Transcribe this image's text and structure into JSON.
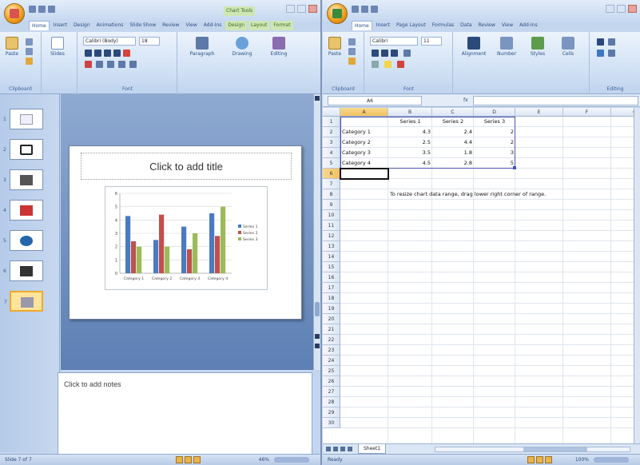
{
  "powerpoint": {
    "title_text": "",
    "tabs": [
      "Home",
      "Insert",
      "Design",
      "Animations",
      "Slide Show",
      "Review",
      "View",
      "Add-Ins",
      "Design",
      "Layout",
      "Format"
    ],
    "contextual_tab": "Chart Tools",
    "ribbon": {
      "paste_label": "Paste",
      "slides_label": "Slides",
      "font_name": "Calibri (Body)",
      "font_size": "18",
      "paragraph_label": "Paragraph",
      "drawing_label": "Drawing",
      "editing_label": "Editing",
      "clipboard_group": "Clipboard",
      "font_group": "Font"
    },
    "thumbnails": [
      {
        "num": "1",
        "icon": "title-slide"
      },
      {
        "num": "2",
        "icon": "shapes"
      },
      {
        "num": "3",
        "icon": "image"
      },
      {
        "num": "4",
        "icon": "diagram"
      },
      {
        "num": "5",
        "icon": "globe"
      },
      {
        "num": "6",
        "icon": "photo"
      },
      {
        "num": "7",
        "icon": "chart"
      }
    ],
    "slide": {
      "title_placeholder": "Click to add title"
    },
    "notes_placeholder": "Click to add notes",
    "status": {
      "slide_info": "Slide 7 of 7",
      "zoom": "46%"
    }
  },
  "excel": {
    "title_text": "",
    "tabs": [
      "Home",
      "Insert",
      "Page Layout",
      "Formulas",
      "Data",
      "Review",
      "View",
      "Add-Ins"
    ],
    "ribbon": {
      "paste_label": "Paste",
      "font_name": "Calibri",
      "font_size": "11",
      "alignment_label": "Alignment",
      "number_label": "Number",
      "styles_label": "Styles",
      "cells_label": "Cells",
      "clipboard_group": "Clipboard",
      "font_group": "Font",
      "editing_group": "Editing"
    },
    "name_box": "A6",
    "fx_label": "fx",
    "columns": [
      "A",
      "B",
      "C",
      "D",
      "E",
      "F",
      "G"
    ],
    "rows": [
      "1",
      "2",
      "3",
      "4",
      "5",
      "6",
      "7",
      "8",
      "9",
      "10",
      "11",
      "12",
      "13",
      "14",
      "15",
      "16",
      "17",
      "18",
      "19",
      "20",
      "21",
      "22",
      "23",
      "24",
      "25",
      "26",
      "27",
      "28",
      "29",
      "30"
    ],
    "cells": {
      "B1": "Series 1",
      "C1": "Series 2",
      "D1": "Series 3",
      "A2": "Category 1",
      "B2": "4.3",
      "C2": "2.4",
      "D2": "2",
      "A3": "Category 2",
      "B3": "2.5",
      "C3": "4.4",
      "D3": "2",
      "A4": "Category 3",
      "B4": "3.5",
      "C4": "1.8",
      "D4": "3",
      "A5": "Category 4",
      "B5": "4.5",
      "C5": "2.8",
      "D5": "5",
      "B8": "To resize chart data range, drag lower right corner of range."
    },
    "sheet_tab": "Sheet1",
    "status": {
      "ready": "Ready",
      "zoom": "100%"
    }
  },
  "chart_data": {
    "type": "bar",
    "categories": [
      "Category 1",
      "Category 2",
      "Category 3",
      "Category 4"
    ],
    "series": [
      {
        "name": "Series 1",
        "values": [
          4.3,
          2.5,
          3.5,
          4.5
        ],
        "color": "#4a7bc0"
      },
      {
        "name": "Series 2",
        "values": [
          2.4,
          4.4,
          1.8,
          2.8
        ],
        "color": "#c0504d"
      },
      {
        "name": "Series 3",
        "values": [
          2,
          2,
          3,
          5
        ],
        "color": "#9bbb59"
      }
    ],
    "ylim": [
      0,
      6
    ],
    "yticks": [
      "0",
      "1",
      "2",
      "3",
      "4",
      "5",
      "6"
    ],
    "grid": true,
    "legend_position": "right"
  },
  "colors": {
    "office_blue": "#c4d6ee",
    "accent_orange": "#f0a92c"
  }
}
